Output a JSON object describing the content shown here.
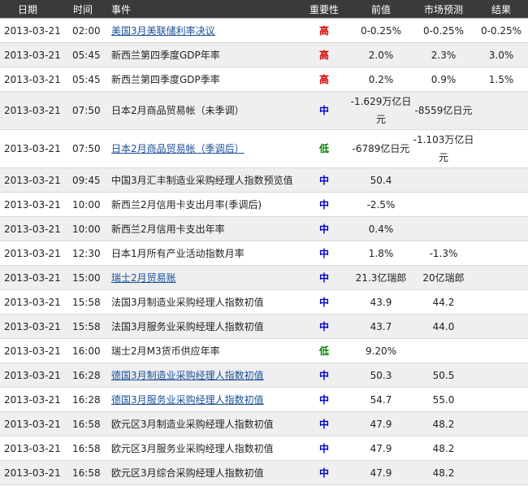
{
  "headers": {
    "date": "日期",
    "time": "时间",
    "event": "事件",
    "importance": "重要性",
    "previous": "前值",
    "forecast": "市场预测",
    "actual": "结果"
  },
  "colors": {
    "header_bg": "#3a3a3a",
    "alt_row_bg": "#efefef",
    "link": "#1a4f9a",
    "importance_high": "#d00000",
    "importance_medium": "#0000c8",
    "importance_low": "#008000"
  },
  "rows": [
    {
      "date": "2013-03-21",
      "time": "02:00",
      "event": "美国3月美联储利率决议",
      "link": true,
      "importance": "高",
      "level": "high",
      "previous": "0-0.25%",
      "forecast": "0-0.25%",
      "actual": "0-0.25%"
    },
    {
      "date": "2013-03-21",
      "time": "05:45",
      "event": "新西兰第四季度GDP年率",
      "link": false,
      "importance": "高",
      "level": "high",
      "previous": "2.0%",
      "forecast": "2.3%",
      "actual": "3.0%"
    },
    {
      "date": "2013-03-21",
      "time": "05:45",
      "event": "新西兰第四季度GDP季率",
      "link": false,
      "importance": "高",
      "level": "high",
      "previous": "0.2%",
      "forecast": "0.9%",
      "actual": "1.5%"
    },
    {
      "date": "2013-03-21",
      "time": "07:50",
      "event": "日本2月商品贸易帐（未季调）",
      "link": false,
      "importance": "中",
      "level": "medium",
      "previous": "-1.629万亿日元",
      "forecast": "-8559亿日元",
      "actual": ""
    },
    {
      "date": "2013-03-21",
      "time": "07:50",
      "event": "日本2月商品贸易帐（季调后）",
      "link": true,
      "importance": "低",
      "level": "low",
      "previous": "-6789亿日元",
      "forecast": "-1.103万亿日元",
      "actual": ""
    },
    {
      "date": "2013-03-21",
      "time": "09:45",
      "event": "中国3月汇丰制造业采购经理人指数预览值",
      "link": false,
      "importance": "中",
      "level": "medium",
      "previous": "50.4",
      "forecast": "",
      "actual": ""
    },
    {
      "date": "2013-03-21",
      "time": "10:00",
      "event": "新西兰2月信用卡支出月率(季调后)",
      "link": false,
      "importance": "中",
      "level": "medium",
      "previous": "-2.5%",
      "forecast": "",
      "actual": ""
    },
    {
      "date": "2013-03-21",
      "time": "10:00",
      "event": "新西兰2月信用卡支出年率",
      "link": false,
      "importance": "中",
      "level": "medium",
      "previous": "0.4%",
      "forecast": "",
      "actual": ""
    },
    {
      "date": "2013-03-21",
      "time": "12:30",
      "event": "日本1月所有产业活动指数月率",
      "link": false,
      "importance": "中",
      "level": "medium",
      "previous": "1.8%",
      "forecast": "-1.3%",
      "actual": ""
    },
    {
      "date": "2013-03-21",
      "time": "15:00",
      "event": "瑞士2月贸易账",
      "link": true,
      "importance": "中",
      "level": "medium",
      "previous": "21.3亿瑞郎",
      "forecast": "20亿瑞郎",
      "actual": ""
    },
    {
      "date": "2013-03-21",
      "time": "15:58",
      "event": "法国3月制造业采购经理人指数初值",
      "link": false,
      "importance": "中",
      "level": "medium",
      "previous": "43.9",
      "forecast": "44.2",
      "actual": ""
    },
    {
      "date": "2013-03-21",
      "time": "15:58",
      "event": "法国3月服务业采购经理人指数初值",
      "link": false,
      "importance": "中",
      "level": "medium",
      "previous": "43.7",
      "forecast": "44.0",
      "actual": ""
    },
    {
      "date": "2013-03-21",
      "time": "16:00",
      "event": "瑞士2月M3货币供应年率",
      "link": false,
      "importance": "低",
      "level": "low",
      "previous": "9.20%",
      "forecast": "",
      "actual": ""
    },
    {
      "date": "2013-03-21",
      "time": "16:28",
      "event": "德国3月制造业采购经理人指数初值",
      "link": true,
      "importance": "中",
      "level": "medium",
      "previous": "50.3",
      "forecast": "50.5",
      "actual": ""
    },
    {
      "date": "2013-03-21",
      "time": "16:28",
      "event": "德国3月服务业采购经理人指数初值",
      "link": true,
      "importance": "中",
      "level": "medium",
      "previous": "54.7",
      "forecast": "55.0",
      "actual": ""
    },
    {
      "date": "2013-03-21",
      "time": "16:58",
      "event": "欧元区3月制造业采购经理人指数初值",
      "link": false,
      "importance": "中",
      "level": "medium",
      "previous": "47.9",
      "forecast": "48.2",
      "actual": ""
    },
    {
      "date": "2013-03-21",
      "time": "16:58",
      "event": "欧元区3月服务业采购经理人指数初值",
      "link": false,
      "importance": "中",
      "level": "medium",
      "previous": "47.9",
      "forecast": "48.2",
      "actual": ""
    },
    {
      "date": "2013-03-21",
      "time": "16:58",
      "event": "欧元区3月综合采购经理人指数初值",
      "link": false,
      "importance": "中",
      "level": "medium",
      "previous": "47.9",
      "forecast": "48.2",
      "actual": ""
    }
  ]
}
